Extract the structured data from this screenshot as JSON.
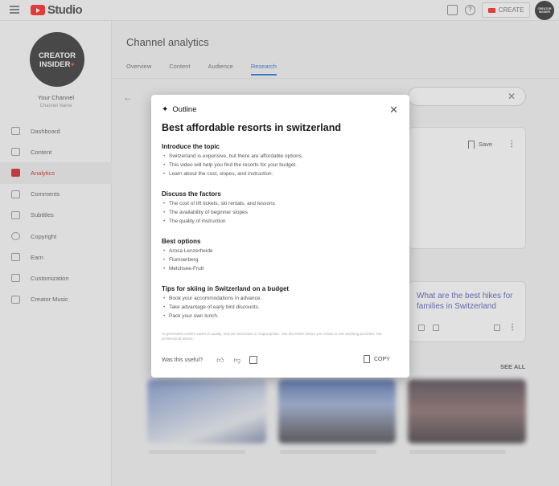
{
  "app": {
    "brand": "Studio"
  },
  "topbar": {
    "create_label": "CREATE",
    "avatar_text": "CREATOR INSIDER"
  },
  "sidebar": {
    "avatar_text": "CREATOR INSIDER",
    "channel_name": "Your Channel",
    "channel_sub": "Channel Name",
    "items": [
      {
        "label": "Dashboard",
        "icon": "dashboard-icon"
      },
      {
        "label": "Content",
        "icon": "content-icon"
      },
      {
        "label": "Analytics",
        "icon": "analytics-icon",
        "active": true
      },
      {
        "label": "Comments",
        "icon": "comments-icon"
      },
      {
        "label": "Subtitles",
        "icon": "subtitles-icon"
      },
      {
        "label": "Copyright",
        "icon": "copyright-icon"
      },
      {
        "label": "Earn",
        "icon": "earn-icon"
      },
      {
        "label": "Customization",
        "icon": "customization-icon"
      },
      {
        "label": "Creator Music",
        "icon": "creator-music-icon"
      }
    ]
  },
  "main": {
    "title": "Channel analytics",
    "tabs": [
      "Overview",
      "Content",
      "Audience",
      "Research"
    ],
    "active_tab": "Research",
    "save_label": "Save",
    "question_card_text": "What are the best hikes for families in Switzerland",
    "see_all_label": "SEE ALL"
  },
  "dialog": {
    "header": "Outline",
    "title": "Best affordable resorts in switzerland",
    "sections": [
      {
        "heading": "Introduce the topic",
        "items": [
          "Switzerland is expensive, but there are affordable options.",
          "This video will help you find the resorts for your budget.",
          "Learn about the cost, slopes, and instruction."
        ]
      },
      {
        "heading": "Discuss the factors",
        "items": [
          "The cost of lift tickets, ski rentals, and lessons",
          "The availability of beginner slopes",
          "The quality of instruction"
        ]
      },
      {
        "heading": "Best options",
        "items": [
          "Arosa Lenzerheide",
          "Flumserberg",
          "Melchsee-Frutt"
        ]
      },
      {
        "heading": "Tips for skiing in Switzerland on a budget",
        "items": [
          "Book your accommodations in advance.",
          "Take advantage of early bird discounts.",
          "Pack your own lunch."
        ]
      }
    ],
    "disclaimer": "AI-generated content varies in quality, may be inaccurate or inappropriate. Use discretion before you create or use anything provided. Not professional advice.",
    "useful_label": "Was this useful?",
    "copy_label": "COPY"
  },
  "colors": {
    "brand_red": "#ff0000",
    "accent_blue": "#065fd4",
    "active_nav": "#cc0000"
  }
}
